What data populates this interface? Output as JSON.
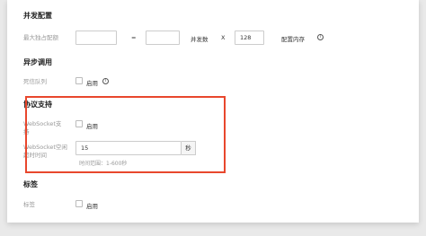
{
  "sections": {
    "concurrency": {
      "title": "并发配置",
      "max_node_label": "最大独占配额",
      "equals": "=",
      "concurrency_label": "并发数",
      "times": "X",
      "memory_value": "128",
      "memory_label": "配置内存"
    },
    "async": {
      "title": "异步调用",
      "dead_letter_label": "死信队列",
      "enable_label": "启用"
    },
    "protocol": {
      "title": "协议支持",
      "websocket_label": "WebSocket支持",
      "enable_label": "启用",
      "idle_timeout_label": "WebSocket空闲超时时间",
      "idle_timeout_value": "15",
      "idle_timeout_unit": "秒",
      "idle_timeout_hint": "时间范围：1-600秒"
    },
    "tags": {
      "title": "标签",
      "tags_label": "标签",
      "enable_label": "启用"
    }
  },
  "colors": {
    "highlight_border": "#e8472d"
  }
}
